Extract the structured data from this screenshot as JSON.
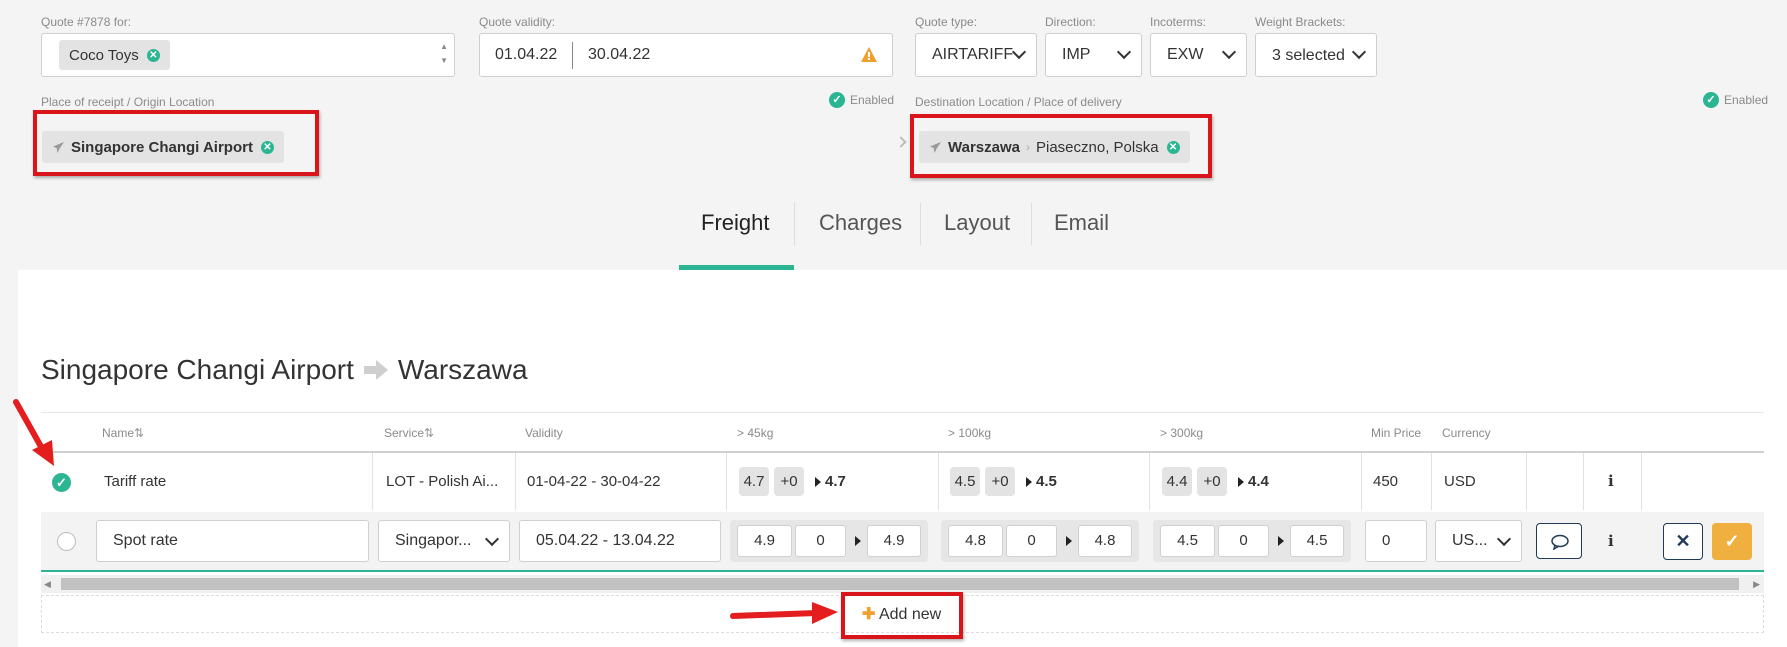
{
  "quote": {
    "for_label": "Quote #7878 for:",
    "customer_tag": "Coco Toys",
    "validity_label": "Quote validity:",
    "validity_from": "01.04.22",
    "validity_to": "30.04.22",
    "type_label": "Quote type:",
    "type_value": "AIRTARIFF",
    "direction_label": "Direction:",
    "direction_value": "IMP",
    "incoterms_label": "Incoterms:",
    "incoterms_value": "EXW",
    "weight_label": "Weight Brackets:",
    "weight_value": "3 selected"
  },
  "origin": {
    "label": "Place of receipt / Origin Location",
    "enabled": "Enabled",
    "tag": "Singapore Changi Airport"
  },
  "destination": {
    "label": "Destination Location / Place of delivery",
    "enabled": "Enabled",
    "tag_bold": "Warszawa",
    "tag_rest": "Piaseczno, Polska"
  },
  "tabs": [
    {
      "label": "Freight",
      "active": true
    },
    {
      "label": "Charges",
      "active": false
    },
    {
      "label": "Layout",
      "active": false
    },
    {
      "label": "Email",
      "active": false
    }
  ],
  "route": {
    "from": "Singapore Changi Airport",
    "to": "Warszawa"
  },
  "table": {
    "headers": [
      "Name",
      "Service",
      "Validity",
      "> 45kg",
      "> 100kg",
      "> 300kg",
      "Min Price",
      "Currency"
    ],
    "tariff_row": {
      "name": "Tariff rate",
      "service": "LOT - Polish Ai...",
      "validity": "01-04-22 - 30-04-22",
      "b45": {
        "base": "4.7",
        "add": "+0",
        "total": "4.7"
      },
      "b100": {
        "base": "4.5",
        "add": "+0",
        "total": "4.5"
      },
      "b300": {
        "base": "4.4",
        "add": "+0",
        "total": "4.4"
      },
      "min_price": "450",
      "currency": "USD"
    },
    "spot_row": {
      "name": "Spot rate",
      "service": "Singapor...",
      "validity": "05.04.22 - 13.04.22",
      "b45": {
        "base": "4.9",
        "add": "0",
        "total": "4.9"
      },
      "b100": {
        "base": "4.8",
        "add": "0",
        "total": "4.8"
      },
      "b300": {
        "base": "4.5",
        "add": "0",
        "total": "4.5"
      },
      "min_price": "0",
      "currency": "US..."
    },
    "add_new": "Add new"
  },
  "colors": {
    "accent": "#2bb592",
    "warning": "#f0a030",
    "confirm": "#f0b040",
    "annotation": "#d9151b"
  }
}
